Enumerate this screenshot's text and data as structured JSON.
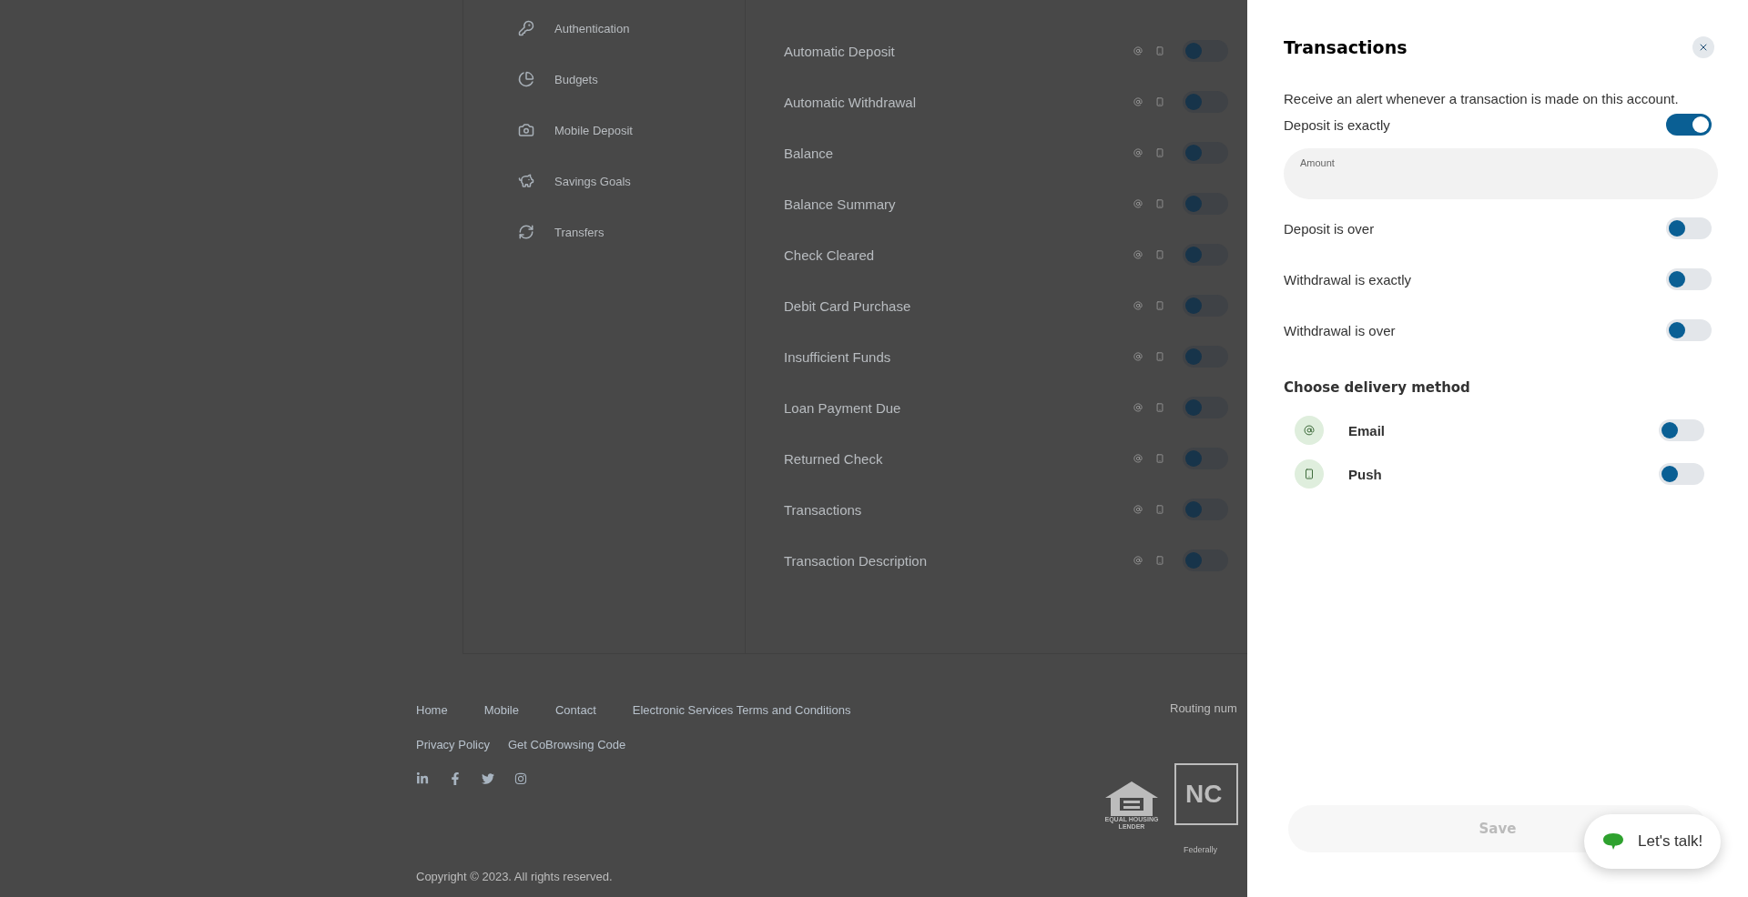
{
  "sidebar": {
    "items": [
      {
        "label": "Authentication"
      },
      {
        "label": "Budgets"
      },
      {
        "label": "Mobile Deposit"
      },
      {
        "label": "Savings Goals"
      },
      {
        "label": "Transfers"
      }
    ]
  },
  "alerts": {
    "rows": [
      {
        "label": "Automatic Deposit",
        "on": false
      },
      {
        "label": "Automatic Withdrawal",
        "on": false
      },
      {
        "label": "Balance",
        "on": false
      },
      {
        "label": "Balance Summary",
        "on": false
      },
      {
        "label": "Check Cleared",
        "on": false
      },
      {
        "label": "Debit Card Purchase",
        "on": false
      },
      {
        "label": "Insufficient Funds",
        "on": false
      },
      {
        "label": "Loan Payment Due",
        "on": false
      },
      {
        "label": "Returned Check",
        "on": false
      },
      {
        "label": "Transactions",
        "on": false
      },
      {
        "label": "Transaction Description",
        "on": false
      }
    ]
  },
  "footer": {
    "links": [
      "Home",
      "Mobile",
      "Contact",
      "Electronic Services Terms and Conditions"
    ],
    "links_2": [
      "Privacy Policy",
      "Get CoBrowsing Code"
    ],
    "routing": "Routing num",
    "copyright": "Copyright © 2023. All rights reserved.",
    "housing_badge": [
      "EQUAL HOUSING",
      "LENDER"
    ],
    "ncua_badge": "NC",
    "ncua_caption": "Federally"
  },
  "panel": {
    "title": "Transactions",
    "description": "Receive an alert whenever a transaction is made on this account.",
    "conditions": [
      {
        "label": "Deposit is exactly",
        "on": true,
        "field": {
          "label": "Amount"
        }
      },
      {
        "label": "Deposit is over",
        "on": false
      },
      {
        "label": "Withdrawal is exactly",
        "on": false
      },
      {
        "label": "Withdrawal is over",
        "on": false
      }
    ],
    "delivery": {
      "heading": "Choose delivery method",
      "methods": [
        {
          "label": "Email",
          "on": false
        },
        {
          "label": "Push",
          "on": false
        }
      ]
    },
    "save": {
      "label": "Save",
      "disabled": true
    }
  },
  "chat": {
    "label": "Let's talk!"
  }
}
